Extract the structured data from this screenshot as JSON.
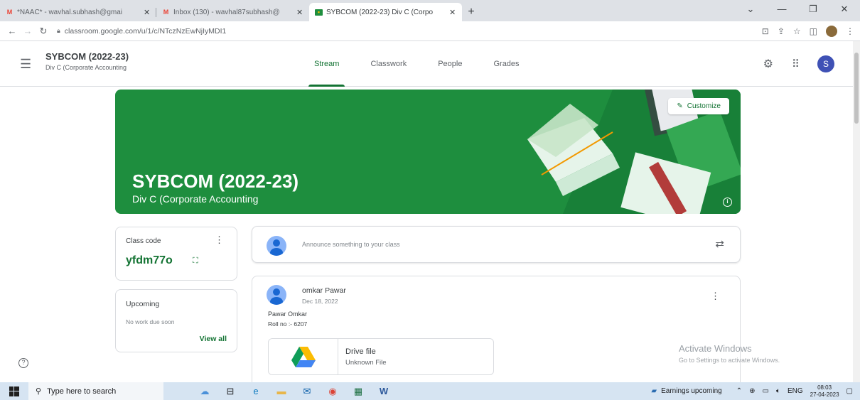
{
  "browser": {
    "tabs": [
      {
        "favicon": "gmail-icon",
        "title": "*NAAC* - wavhal.subhash@gmai",
        "active": false
      },
      {
        "favicon": "gmail-icon",
        "title": "Inbox (130) - wavhal87subhash@",
        "active": false
      },
      {
        "favicon": "classroom-icon",
        "title": "SYBCOM (2022-23) Div C (Corpo",
        "active": true
      }
    ],
    "url": "classroom.google.com/u/1/c/NTczNzEwNjIyMDI1"
  },
  "header": {
    "course_title": "SYBCOM (2022-23)",
    "course_subtitle": "Div C (Corporate Accounting",
    "tabs": [
      {
        "label": "Stream",
        "active": true
      },
      {
        "label": "Classwork",
        "active": false
      },
      {
        "label": "People",
        "active": false
      },
      {
        "label": "Grades",
        "active": false
      }
    ],
    "avatar_letter": "S"
  },
  "banner": {
    "title": "SYBCOM (2022-23)",
    "subtitle": "Div C (Corporate Accounting",
    "customize_label": "Customize",
    "color": "#1e8e3e"
  },
  "class_code": {
    "label": "Class code",
    "code": "yfdm77o"
  },
  "upcoming": {
    "label": "Upcoming",
    "empty_text": "No work due soon",
    "view_all": "View all"
  },
  "announce": {
    "placeholder": "Announce something to your class"
  },
  "post": {
    "author": "omkar Pawar",
    "date": "Dec 18, 2022",
    "line1": "Pawar Omkar",
    "line2": "Roll no :- 6207",
    "attachment": {
      "name": "Drive file",
      "type": "Unknown File"
    }
  },
  "watermark": {
    "title": "Activate Windows",
    "subtitle": "Go to Settings to activate Windows."
  },
  "taskbar": {
    "search_placeholder": "Type here to search",
    "news": "Earnings upcoming",
    "lang": "ENG",
    "time": "08:03",
    "date": "27-04-2023"
  },
  "colors": {
    "accent": "#137333",
    "avatar": "#3f51b5"
  }
}
